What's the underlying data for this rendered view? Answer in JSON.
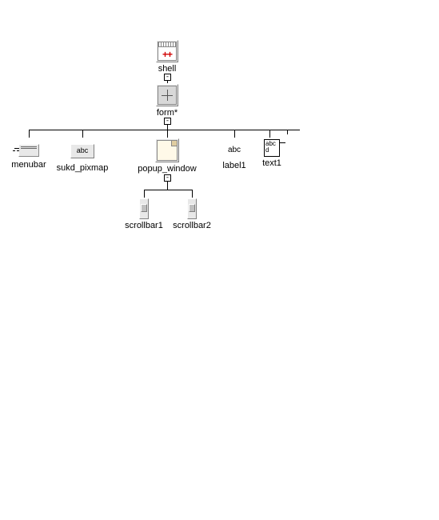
{
  "nodes": {
    "shell": {
      "label": "shell",
      "toggle": "-"
    },
    "form": {
      "label": "form*",
      "toggle": "-"
    },
    "menubar": {
      "label": "menubar"
    },
    "sukd_pixmap": {
      "label": "sukd_pixmap",
      "iconText": "abc"
    },
    "popup_window": {
      "label": "popup_window",
      "toggle": "-"
    },
    "label1": {
      "label": "label1",
      "iconText": "abc"
    },
    "text1": {
      "label": "text1",
      "iconText": "abc\nd"
    },
    "scrollbar1": {
      "label": "scrollbar1"
    },
    "scrollbar2": {
      "label": "scrollbar2"
    }
  },
  "icons": {
    "shell_plusplus": "++"
  }
}
